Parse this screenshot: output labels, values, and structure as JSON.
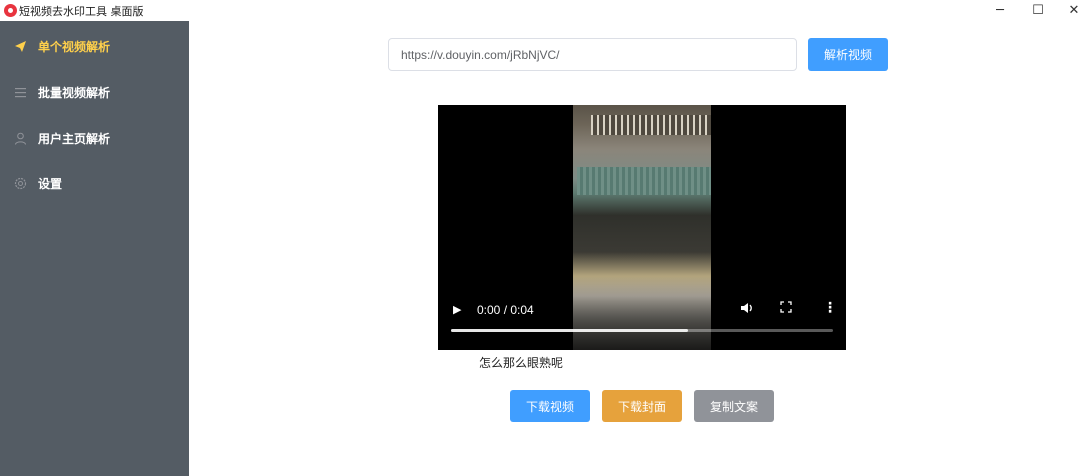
{
  "window": {
    "title": "短视频去水印工具 桌面版",
    "minimize": "─",
    "maximize": "☐",
    "close": "✕"
  },
  "sidebar": {
    "items": [
      {
        "label": "单个视频解析",
        "icon": "paper-plane-icon",
        "active": true
      },
      {
        "label": "批量视频解析",
        "icon": "menu-icon",
        "active": false
      },
      {
        "label": "用户主页解析",
        "icon": "user-icon",
        "active": false
      },
      {
        "label": "设置",
        "icon": "gear-icon",
        "active": false
      }
    ]
  },
  "main": {
    "url_value": "https://v.douyin.com/jRbNjVC/",
    "parse_button": "解析视频",
    "video": {
      "time": "0:00 / 0:04",
      "progress": 0.62
    },
    "caption": "怎么那么眼熟呢",
    "buttons": {
      "download_video": "下载视频",
      "download_cover": "下载封面",
      "copy_text": "复制文案"
    }
  },
  "colors": {
    "sidebar_bg": "#545c64",
    "active_text": "#ffd04b",
    "primary": "#409eff",
    "warning": "#e6a23c",
    "info": "#909399"
  }
}
